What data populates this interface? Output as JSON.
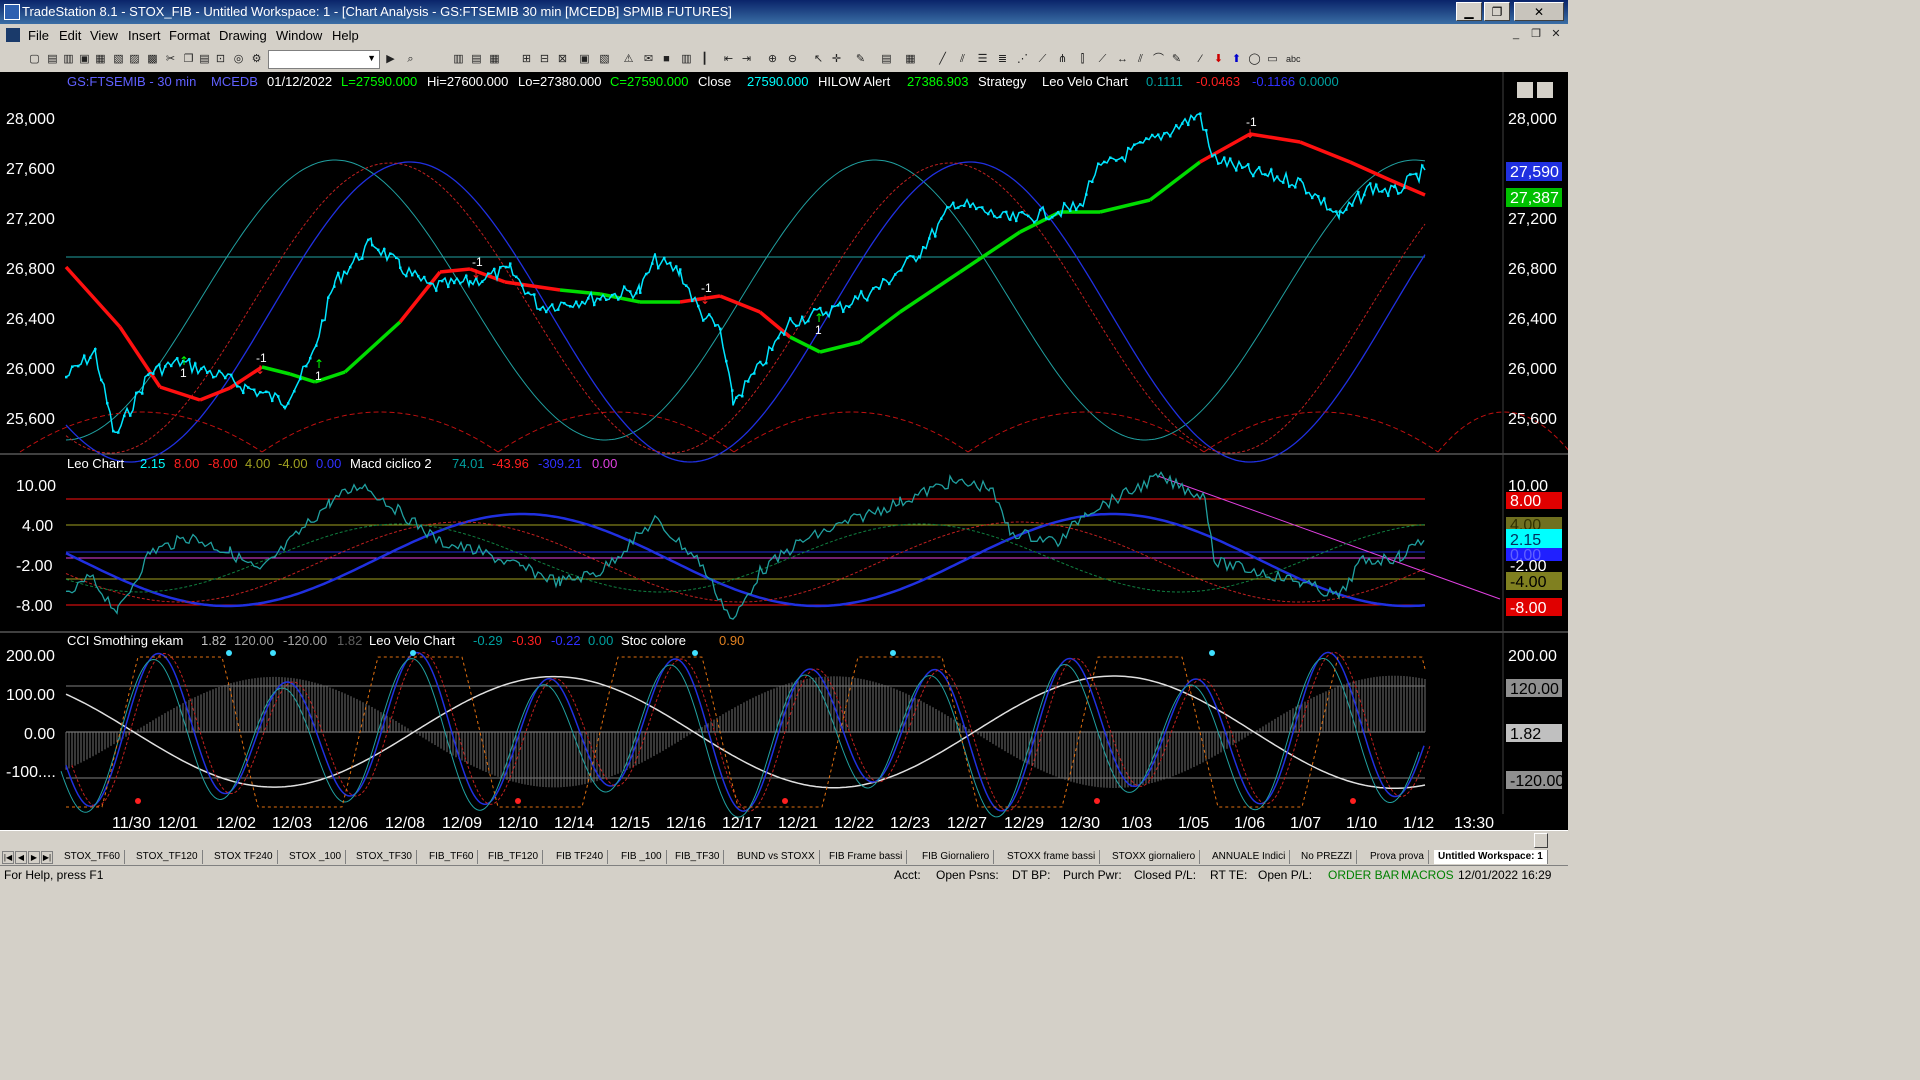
{
  "window": {
    "title": "TradeStation 8.1 - STOX_FIB - Untitled Workspace:  1 - [Chart Analysis - GS:FTSEMIB  30 min  [MCEDB] SPMIB FUTURES]",
    "btn_min": "▁",
    "btn_max": "❐",
    "btn_close": "✕"
  },
  "menu": {
    "items": [
      "File",
      "Edit",
      "View",
      "Insert",
      "Format",
      "Drawing",
      "Window",
      "Help"
    ],
    "mdi_min": "_",
    "mdi_restore": "❐",
    "mdi_close": "✕"
  },
  "toolbar": {
    "symbol_value": ""
  },
  "chart": {
    "header": {
      "symbol": "GS:FTSEMIB - 30 min",
      "feed": "MCEDB",
      "date": "01/12/2022",
      "last": "L=27590.000",
      "high": "Hi=27600.000",
      "low": "Lo=27380.000",
      "close_eq": "C=27590.000",
      "close_label": "Close",
      "close_val": "27590.000",
      "hilow_label": "HILOW Alert",
      "hilow_val": "27386.903",
      "strategy_label": "Strategy",
      "velo_label": "Leo Velo Chart",
      "velo_v1": "0.1111",
      "velo_v2": "-0.0463",
      "velo_v3": "-0.1166",
      "velo_v4": "0.0000"
    },
    "price_axis": [
      "28,000",
      "27,600",
      "27,200",
      "26,800",
      "26,400",
      "26,000",
      "25,600"
    ],
    "price_last_badge": "27,590",
    "price_hilow_badge": "27,387",
    "sub1_header": {
      "label": "Leo Chart",
      "v1": "2.15",
      "v2": "8.00",
      "v3": "-8.00",
      "v4": "4.00",
      "v5": "-4.00",
      "v6": "0.00",
      "macd_label": "Macd ciclico 2",
      "m1": "74.01",
      "m2": "-43.96",
      "m3": "-309.21",
      "m4": "0.00"
    },
    "sub1_axis": [
      "10.00",
      "4.00",
      "-2.00",
      "-8.00"
    ],
    "sub1_badges": {
      "b8": "8.00",
      "b4": "4.00",
      "b215": "2.15",
      "b0": "0.00",
      "bm2": "-2.00",
      "bm4": "-4.00",
      "bm8": "-8.00"
    },
    "sub2_header": {
      "label": "CCI Smothing ekam",
      "v1": "1.82",
      "v2": "120.00",
      "v3": "-120.00",
      "v4": "1.82",
      "velo_label": "Leo Velo Chart",
      "w1": "-0.29",
      "w2": "-0.30",
      "w3": "-0.22",
      "w4": "0.00",
      "stoc_label": "Stoc colore",
      "stoc_val": "0.90"
    },
    "sub2_axis": [
      "200.00",
      "100.00",
      "0.00",
      "-100...."
    ],
    "sub2_badges": {
      "b120": "120.00",
      "b182": "1.82",
      "bm120": "-120.00"
    },
    "date_axis": [
      "11/30",
      "12/01",
      "12/02",
      "12/03",
      "12/06",
      "12/08",
      "12/09",
      "12/10",
      "12/14",
      "12/15",
      "12/16",
      "12/17",
      "12/21",
      "12/22",
      "12/23",
      "12/27",
      "12/29",
      "12/30",
      "1/03",
      "1/05",
      "1/06",
      "1/07",
      "1/10",
      "1/12",
      "13:30"
    ],
    "strategy_marks": [
      "1",
      "-1",
      "1",
      "-1",
      "-1",
      "1",
      "-1"
    ],
    "colors": {
      "price": "#00e5ff",
      "hilow_up": "#00dd00",
      "hilow_down": "#ff1010",
      "cycle_blue": "#2030e0",
      "cycle_red": "#c02020",
      "cycle_teal": "#20a0a0",
      "magenta": "#e040e0"
    }
  },
  "tabs": [
    "STOX_TF60",
    "STOX_TF120",
    "STOX TF240",
    "STOX _100",
    "STOX_TF30",
    "FIB_TF60",
    "FIB_TF120",
    "FIB TF240",
    "FIB _100",
    "FIB_TF30",
    "BUND vs STOXX",
    "FIB Frame bassi",
    "FIB Giornaliero",
    "STOXX frame bassi",
    "STOXX giornaliero",
    "ANNUALE Indici",
    "No PREZZI",
    "Prova prova",
    "Untitled Workspace:  1"
  ],
  "status": {
    "help": "For Help, press F1",
    "acct": "Acct:",
    "open_psns": "Open Psns:",
    "dt_bp": "DT BP:",
    "purch_pwr": "Purch Pwr:",
    "closed_pl": "Closed P/L:",
    "rt_te": "RT TE:",
    "open_pl": "Open P/L:",
    "order_bar": "ORDER BAR",
    "macros": "MACROS",
    "datetime": "12/01/2022 16:29"
  }
}
